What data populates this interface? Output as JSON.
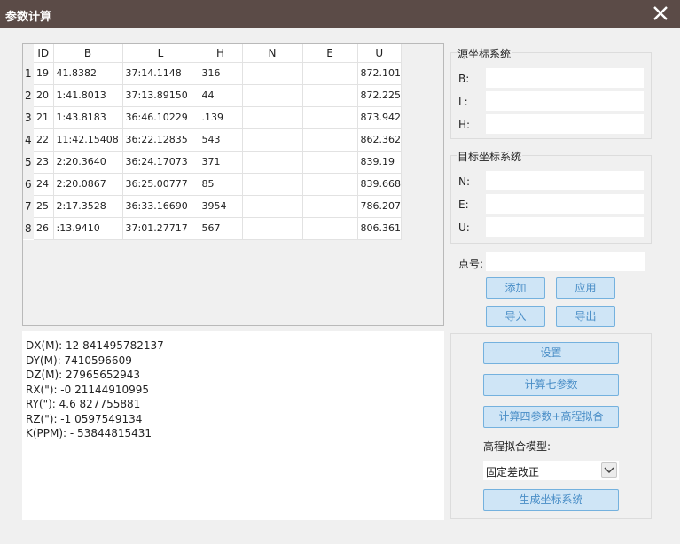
{
  "window": {
    "title": "参数计算"
  },
  "table": {
    "headers": [
      "ID",
      "B",
      "L",
      "H",
      "N",
      "E",
      "U"
    ],
    "rows": [
      {
        "num": "1",
        "id": "19",
        "b": "41.8382",
        "l": "37:14.1148",
        "h": "316",
        "n": "",
        "e": "",
        "u": "872.101"
      },
      {
        "num": "2",
        "id": "20",
        "b": "1:41.8013",
        "l": "37:13.89150",
        "h": "44",
        "n": "",
        "e": "",
        "u": "872.225"
      },
      {
        "num": "3",
        "id": "21",
        "b": "1:43.8183",
        "l": "36:46.10229",
        "h": ".139",
        "n": "",
        "e": "",
        "u": "873.942"
      },
      {
        "num": "4",
        "id": "22",
        "b": "11:42.15408",
        "l": "36:22.12835",
        "h": "543",
        "n": "",
        "e": "",
        "u": "862.362"
      },
      {
        "num": "5",
        "id": "23",
        "b": "2:20.3640",
        "l": "36:24.17073",
        "h": "371",
        "n": "",
        "e": "",
        "u": "839.19"
      },
      {
        "num": "6",
        "id": "24",
        "b": "2:20.0867",
        "l": "36:25.00777",
        "h": "85",
        "n": "",
        "e": "",
        "u": "839.668"
      },
      {
        "num": "7",
        "id": "25",
        "b": "2:17.3528",
        "l": "36:33.16690",
        "h": "3954",
        "n": "",
        "e": "",
        "u": "786.207"
      },
      {
        "num": "8",
        "id": "26",
        "b": ":13.9410",
        "l": "37:01.27717",
        "h": "567",
        "n": "",
        "e": "",
        "u": "806.361"
      }
    ]
  },
  "results": [
    "DX(M): 12 841495782137",
    "DY(M): 7410596609",
    "DZ(M): 27965652943",
    "RX(\"): -0 21144910995",
    "RY(\"): 4.6 827755881",
    "RZ(\"): -1 0597549134",
    "K(PPM): - 53844815431"
  ],
  "source_group": {
    "title": "源坐标系统",
    "b_label": "B:",
    "l_label": "L:",
    "h_label": "H:",
    "b_value": "",
    "l_value": "",
    "h_value": ""
  },
  "target_group": {
    "title": "目标坐标系统",
    "n_label": "N:",
    "e_label": "E:",
    "u_label": "U:",
    "n_value": "",
    "e_value": "",
    "u_value": ""
  },
  "point": {
    "label": "点号:",
    "value": ""
  },
  "buttons": {
    "add": "添加",
    "apply": "应用",
    "import": "导入",
    "export": "导出",
    "settings": "设置",
    "calc_seven": "计算七参数",
    "calc_four": "计算四参数+高程拟合",
    "generate": "生成坐标系统"
  },
  "height_model": {
    "label": "高程拟合模型:",
    "selected": "固定差改正"
  },
  "colors": {
    "titlebar": "#5b4b47",
    "button_bg": "#cfe5f6",
    "button_border": "#74b1de",
    "button_text": "#4a8ec7"
  }
}
